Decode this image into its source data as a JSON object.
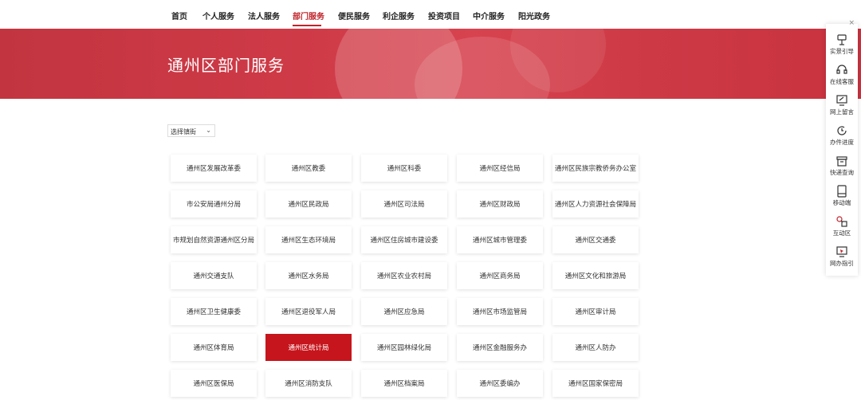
{
  "nav": {
    "items": [
      "首页",
      "个人服务",
      "法人服务",
      "部门服务",
      "便民服务",
      "利企服务",
      "投资项目",
      "中介服务",
      "阳光政务"
    ],
    "active": "部门服务"
  },
  "banner": {
    "title": "通州区部门服务"
  },
  "filter": {
    "label": "选择镇街"
  },
  "departments": [
    "通州区发展改革委",
    "通州区教委",
    "通州区科委",
    "通州区经信局",
    "通州区民族宗教侨务办公室",
    "市公安局通州分局",
    "通州区民政局",
    "通州区司法局",
    "通州区财政局",
    "通州区人力资源社会保障局",
    "市规划自然资源通州区分局",
    "通州区生态环境局",
    "通州区住房城市建设委",
    "通州区城市管理委",
    "通州区交通委",
    "通州交通支队",
    "通州区水务局",
    "通州区农业农村局",
    "通州区商务局",
    "通州区文化和旅游局",
    "通州区卫生健康委",
    "通州区退役军人局",
    "通州区应急局",
    "通州区市场监管局",
    "通州区审计局",
    "通州区体育局",
    "通州区统计局",
    "通州区园林绿化局",
    "通州区金融服务办",
    "通州区人防办",
    "通州区医保局",
    "通州区消防支队",
    "通州区档案局",
    "通州区委编办",
    "通州区国家保密局"
  ],
  "highlighted_department": "通州区统计局",
  "sidebar": {
    "close": "×",
    "items": [
      {
        "label": "实景引导",
        "icon": "guide-icon"
      },
      {
        "label": "在线客服",
        "icon": "headset-icon"
      },
      {
        "label": "网上留言",
        "icon": "message-icon"
      },
      {
        "label": "办件进度",
        "icon": "progress-icon"
      },
      {
        "label": "快递查询",
        "icon": "package-icon"
      },
      {
        "label": "移动端",
        "icon": "tablet-icon"
      },
      {
        "label": "互动区",
        "icon": "interaction-icon"
      },
      {
        "label": "网办指引",
        "icon": "monitor-guide-icon"
      }
    ]
  },
  "colors": {
    "accent": "#c0242b",
    "banner": "#d13e4a",
    "highlight": "#c6151c"
  }
}
